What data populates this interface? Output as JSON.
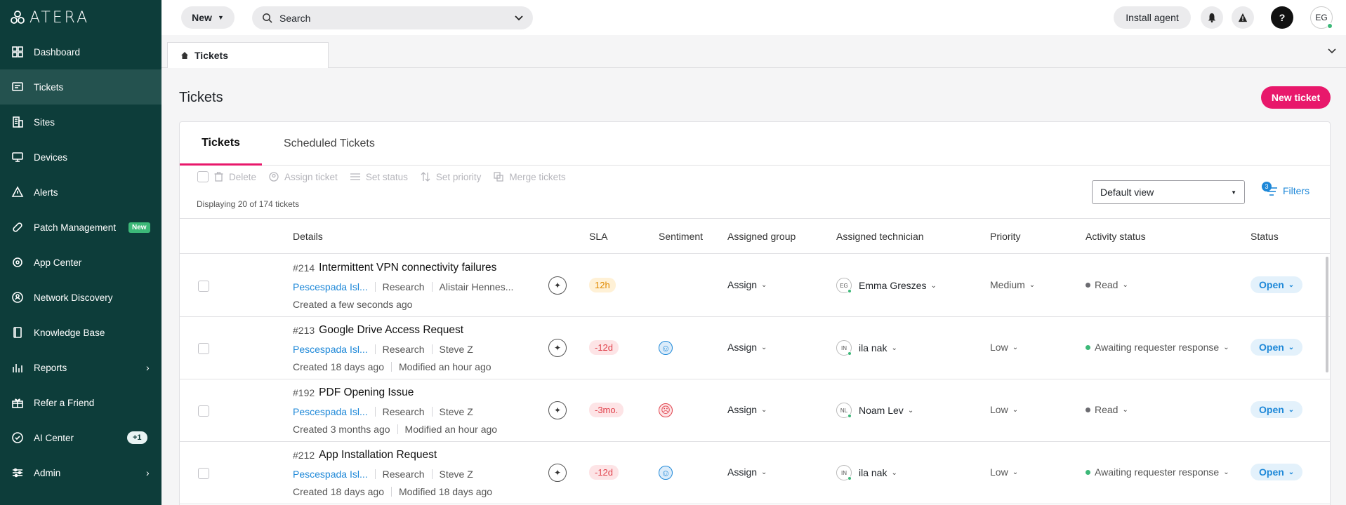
{
  "app": {
    "logo": "ATERA"
  },
  "sidebar": {
    "items": [
      {
        "label": "Dashboard",
        "icon": "dashboard-icon"
      },
      {
        "label": "Tickets",
        "icon": "tickets-icon",
        "active": true
      },
      {
        "label": "Sites",
        "icon": "sites-icon"
      },
      {
        "label": "Devices",
        "icon": "devices-icon"
      },
      {
        "label": "Alerts",
        "icon": "alerts-icon"
      },
      {
        "label": "Patch Management",
        "icon": "patch-icon",
        "badge": "New"
      },
      {
        "label": "App Center",
        "icon": "app-center-icon"
      },
      {
        "label": "Network Discovery",
        "icon": "network-icon"
      },
      {
        "label": "Knowledge Base",
        "icon": "book-icon"
      },
      {
        "label": "Reports",
        "icon": "reports-icon",
        "chevron": true
      },
      {
        "label": "Refer a Friend",
        "icon": "gift-icon"
      },
      {
        "label": "AI Center",
        "icon": "ai-icon",
        "badge": "+1"
      },
      {
        "label": "Admin",
        "icon": "admin-icon",
        "chevron": true
      }
    ]
  },
  "topbar": {
    "new_label": "New",
    "search_placeholder": "Search",
    "install_label": "Install agent",
    "help_label": "?",
    "user_initials": "EG"
  },
  "tabbar": {
    "tab_label": "Tickets"
  },
  "page": {
    "title": "Tickets",
    "new_ticket_label": "New ticket",
    "tabs": [
      "Tickets",
      "Scheduled Tickets"
    ],
    "toolbar": {
      "delete": "Delete",
      "assign": "Assign ticket",
      "set_status": "Set status",
      "set_priority": "Set priority",
      "merge": "Merge tickets"
    },
    "displaying": "Displaying 20 of 174 tickets",
    "view": "Default view",
    "filters_label": "Filters",
    "filters_count": "3"
  },
  "table": {
    "headers": {
      "details": "Details",
      "sla": "SLA",
      "sentiment": "Sentiment",
      "group": "Assigned group",
      "technician": "Assigned technician",
      "priority": "Priority",
      "activity": "Activity status",
      "status": "Status"
    },
    "rows": [
      {
        "id": "#214",
        "title": "Intermittent VPN connectivity failures",
        "site": "Pescespada Isl...",
        "dept": "Research",
        "requester": "Alistair Hennes...",
        "created": "Created a few seconds ago",
        "modified": "",
        "sla": "12h",
        "sla_kind": "warn",
        "sentiment": "",
        "group": "Assign",
        "tech_initials": "EG",
        "tech": "Emma Greszes",
        "priority": "Medium",
        "activity": "Read",
        "activity_color": "#6b6b70",
        "status": "Open"
      },
      {
        "id": "#213",
        "title": "Google Drive Access Request",
        "site": "Pescespada Isl...",
        "dept": "Research",
        "requester": "Steve Z",
        "created": "Created 18 days ago",
        "modified": "Modified an hour ago",
        "sla": "-12d",
        "sla_kind": "neg",
        "sentiment": "happy",
        "group": "Assign",
        "tech_initials": "IN",
        "tech": "ila nak",
        "priority": "Low",
        "activity": "Awaiting requester response",
        "activity_color": "#3cb878",
        "status": "Open"
      },
      {
        "id": "#192",
        "title": "PDF Opening Issue",
        "site": "Pescespada Isl...",
        "dept": "Research",
        "requester": "Steve Z",
        "created": "Created 3 months ago",
        "modified": "Modified an hour ago",
        "sla": "-3mo.",
        "sla_kind": "neg",
        "sentiment": "sad",
        "group": "Assign",
        "tech_initials": "NL",
        "tech": "Noam Lev",
        "priority": "Low",
        "activity": "Read",
        "activity_color": "#6b6b70",
        "status": "Open"
      },
      {
        "id": "#212",
        "title": "App Installation Request",
        "site": "Pescespada Isl...",
        "dept": "Research",
        "requester": "Steve Z",
        "created": "Created 18 days ago",
        "modified": "Modified 18 days ago",
        "sla": "-12d",
        "sla_kind": "neg",
        "sentiment": "happy",
        "group": "Assign",
        "tech_initials": "IN",
        "tech": "ila nak",
        "priority": "Low",
        "activity": "Awaiting requester response",
        "activity_color": "#3cb878",
        "status": "Open"
      }
    ]
  }
}
